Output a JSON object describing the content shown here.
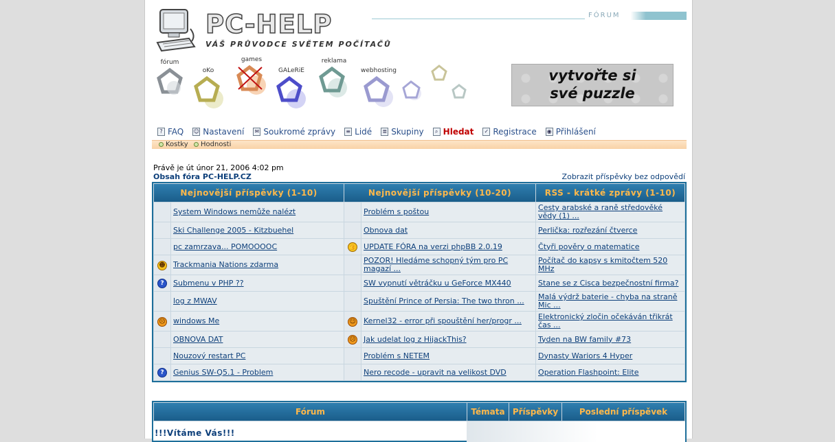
{
  "header": {
    "logo_text": "PC-HELP",
    "slogan": "VÁŠ PRŮVODCE SVĚTEM POČÍTAČŮ",
    "section_tab": "FÓRUM",
    "banner_text_line1": "vytvořte si",
    "banner_text_line2": "své puzzle"
  },
  "nav_icons": [
    {
      "label": "fórum",
      "color": "#9aa0a6"
    },
    {
      "label": "oKo",
      "color": "#c9c06a"
    },
    {
      "label": "games",
      "color": "#e8955a"
    },
    {
      "label": "GALeRiE",
      "color": "#6a6ad6"
    },
    {
      "label": "reklama",
      "color": "#7fa8a0"
    },
    {
      "label": "webhosting",
      "color": "#a9a9d8"
    }
  ],
  "menu": {
    "items": [
      {
        "label": "FAQ"
      },
      {
        "label": "Nastavení"
      },
      {
        "label": "Soukromé zprávy"
      },
      {
        "label": "Lidé"
      },
      {
        "label": "Skupiny"
      },
      {
        "label": "Hledat"
      },
      {
        "label": "Registrace"
      },
      {
        "label": "Přihlášení"
      }
    ],
    "submenu": [
      "Kostky",
      "Hodnosti"
    ]
  },
  "info": {
    "now": "Právě je út únor 21, 2006 4:02 pm",
    "index_link": "Obsah fóra PC-HELP.CZ",
    "unanswered": "Zobrazit příspěvky bez odpovědí"
  },
  "latest": {
    "col1_title": "Nejnovější příspěvky (1-10)",
    "col2_title": "Nejnovější příspěvky (10-20)",
    "col3_title": "RSS - krátké zprávy (1-10)",
    "rows": [
      {
        "icon1": "",
        "t1": "System Windows nemůže nalézt",
        "icon2": "",
        "t2": "Problém s poštou",
        "t3": "Cesty arabské a raně středověké vědy (1) ..."
      },
      {
        "icon1": "",
        "t1": "Ski Challenge 2005 - Kitzbuehel",
        "icon2": "",
        "t2": "Obnova dat",
        "t3": "Perlička: rozřezání čtverce"
      },
      {
        "icon1": "",
        "t1": "pc zamrzava... POMOOOOC",
        "icon2": "thumbs-up-icon",
        "t2": "UPDATE FÓRA na verzi phpBB 2.0.19",
        "t3": "Čtyři pověry o matematice"
      },
      {
        "icon1": "grin-icon",
        "t1": "Trackmania Nations zdarma",
        "icon2": "",
        "t2": "POZOR! Hledáme schopný tým pro PC magazí ...",
        "t3": "Počítač do kapsy s kmitočtem 520 MHz"
      },
      {
        "icon1": "question-icon",
        "t1": "Submenu v PHP ??",
        "icon2": "",
        "t2": "SW vypnutí větráčku u GeForce MX440",
        "t3": "Stane se z Cisca bezpečnostní firma?"
      },
      {
        "icon1": "",
        "t1": "log z MWAV",
        "icon2": "",
        "t2": "Spuštění Prince of Persia: The two thron ...",
        "t3": "Malá výdrž baterie - chyba na straně Mic ..."
      },
      {
        "icon1": "confused-icon",
        "t1": "windows Me",
        "icon2": "smile-icon",
        "t2": "Kernel32 - error při spouštění her/progr ...",
        "t3": "Elektronický zločin očekáván třikrát čas ..."
      },
      {
        "icon1": "",
        "t1": "OBNOVA DAT",
        "icon2": "confused-icon",
        "t2": "Jak udelat log z HijackThis?",
        "t3": "Tyden na BW family #73"
      },
      {
        "icon1": "",
        "t1": "Nouzový restart PC",
        "icon2": "",
        "t2": "Problém s NETEM",
        "t3": "Dynasty Wariors 4 Hyper"
      },
      {
        "icon1": "question-icon",
        "t1": "Genius SW-Q5.1 - Problem",
        "icon2": "",
        "t2": "Nero recode - upravit na velikost DVD",
        "t3": "Operation Flashpoint: Elite"
      }
    ]
  },
  "forum_table": {
    "col_forum": "Fórum",
    "col_topics": "Témata",
    "col_posts": "Příspěvky",
    "col_last": "Poslední příspěvek",
    "welcome": "!!!Vítáme Vás!!!"
  }
}
